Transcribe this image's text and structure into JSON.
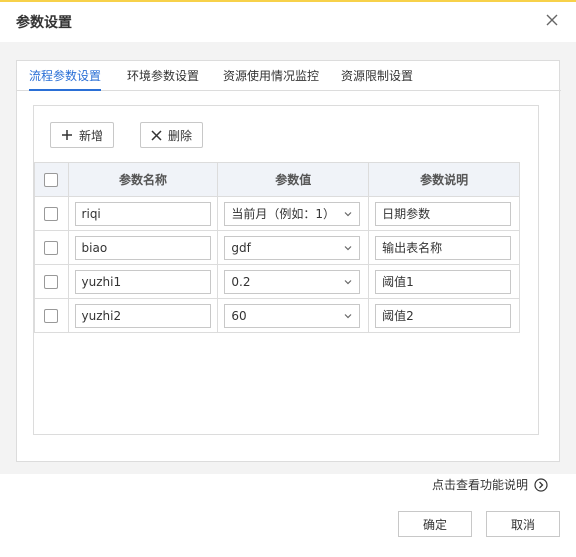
{
  "dialog": {
    "title": "参数设置"
  },
  "tabs": [
    {
      "label": "流程参数设置",
      "active": true
    },
    {
      "label": "环境参数设置",
      "active": false
    },
    {
      "label": "资源使用情况监控",
      "active": false
    },
    {
      "label": "资源限制设置",
      "active": false
    }
  ],
  "toolbar": {
    "add_label": "新增",
    "delete_label": "删除"
  },
  "table": {
    "headers": [
      "参数名称",
      "参数值",
      "参数说明"
    ],
    "rows": [
      {
        "name": "riqi",
        "value": "当前月（例如：1）",
        "desc": "日期参数"
      },
      {
        "name": "biao",
        "value": "gdf",
        "desc": "输出表名称"
      },
      {
        "name": "yuzhi1",
        "value": "0.2",
        "desc": "阈值1"
      },
      {
        "name": "yuzhi2",
        "value": "60",
        "desc": "阈值2"
      }
    ]
  },
  "footer": {
    "help_link": "点击查看功能说明",
    "ok_label": "确定",
    "cancel_label": "取消"
  },
  "colors": {
    "accent": "#2a6fd6",
    "topline": "#f7d14a",
    "header_bg": "#f0f3f8"
  }
}
